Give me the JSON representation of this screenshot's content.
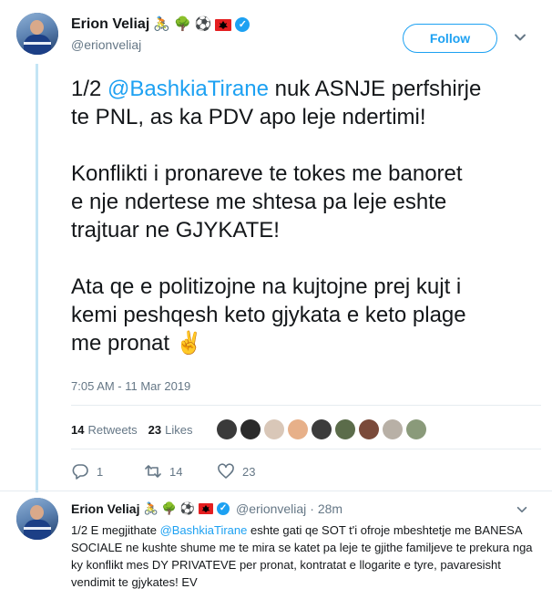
{
  "author": {
    "display_name": "Erion Veliaj",
    "handle": "@erionveliaj",
    "name_emojis": [
      "🚴",
      "🌳",
      "⚽",
      "🇦🇱"
    ]
  },
  "follow_button": {
    "label": "Follow"
  },
  "tweet": {
    "line1_prefix": "1/2 ",
    "line1_mention": "@BashkiaTirane",
    "line1_rest": " nuk ASNJE perfshirje",
    "line2": "te PNL, as ka PDV apo leje ndertimi!",
    "para2_line1": "Konflikti i pronareve te tokes me banoret",
    "para2_line2": "e nje ndertese me shtesa pa leje eshte",
    "para2_line3": "trajtuar ne GJYKATE!",
    "para3_line1": "Ata qe e politizojne na kujtojne prej kujt i",
    "para3_line2": "kemi peshqesh keto gjykata e keto plage",
    "para3_line3": "me pronat",
    "para3_emoji": "✌️",
    "timestamp": "7:05 AM - 11 Mar 2019"
  },
  "stats": {
    "retweets_count": "14",
    "retweets_label": "Retweets",
    "likes_count": "23",
    "likes_label": "Likes"
  },
  "liker_colors": [
    "#3a3a3a",
    "#2b2b2b",
    "#d9c7b8",
    "#e7b089",
    "#3c3c3c",
    "#5b6c4a",
    "#7a4a3a",
    "#b8b0a6",
    "#8a9a7a"
  ],
  "actions": {
    "reply_count": "1",
    "retweet_count": "14",
    "like_count": "23"
  },
  "reply": {
    "display_name": "Erion Veliaj",
    "handle": "@erionveliaj",
    "time": "· 28m",
    "text_prefix": "1/2 E megjithate ",
    "text_mention": "@BashkiaTirane",
    "text_rest": " eshte gati qe SOT t'i ofroje mbeshtetje me BANESA SOCIALE ne kushte shume me te mira se katet pa leje te gjithe familjeve te prekura nga ky konflikt mes DY PRIVATEVE per pronat, kontratat e llogarite e tyre, pavaresisht vendimit te gjykates! EV"
  },
  "colors": {
    "accent": "#1da1f2",
    "thread_line": "#c4e5f5",
    "secondary_text": "#657786"
  }
}
